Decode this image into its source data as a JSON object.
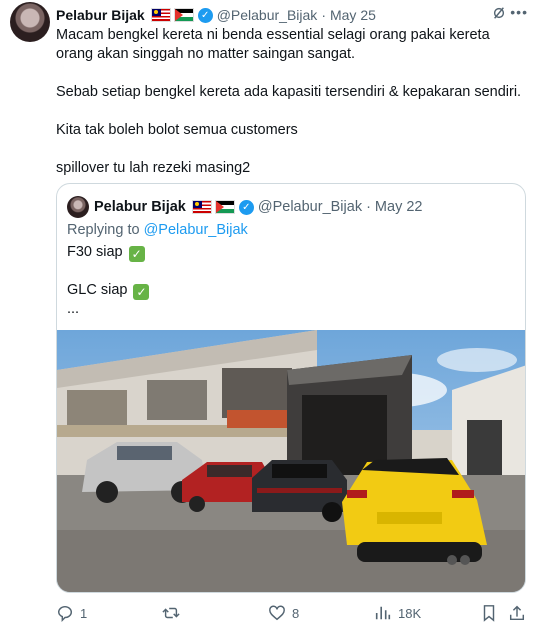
{
  "tweet": {
    "display_name": "Pelabur Bijak",
    "handle": "@Pelabur_Bijak",
    "separator": "·",
    "date": "May 25",
    "paragraphs": [
      "Macam bengkel kereta ni benda essential selagi orang pakai kereta orang akan singgah no matter saingan sangat.",
      "Sebab setiap bengkel kereta ada kapasiti tersendiri & kepakaran sendiri.",
      "Kita tak boleh bolot semua customers",
      "spillover tu lah rezeki masing2"
    ]
  },
  "quoted_tweet": {
    "display_name": "Pelabur Bijak",
    "handle": "@Pelabur_Bijak",
    "separator": "·",
    "date": "May 22",
    "replying_prefix": "Replying to",
    "replying_to": "@Pelabur_Bijak",
    "line1": "F30 siap",
    "line2": "GLC siap",
    "line3": "..."
  },
  "actions": {
    "replies": "1",
    "retweets": "",
    "likes": "8",
    "views": "18K"
  },
  "icons": [
    "more-icon",
    "grok-icon",
    "verified-icon",
    "reply-icon",
    "retweet-icon",
    "like-icon",
    "views-icon",
    "bookmark-icon",
    "share-icon"
  ],
  "colors": {
    "accent": "#1d9bf0",
    "muted": "#536471",
    "border": "#cfd9de",
    "check": "#67b346"
  }
}
